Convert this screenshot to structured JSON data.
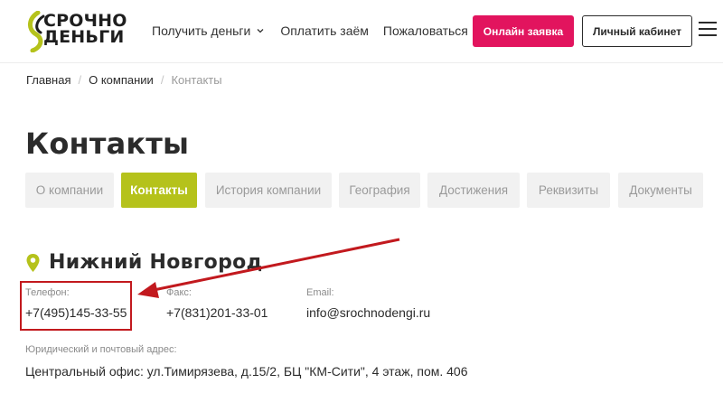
{
  "header": {
    "logo_line1": "СРОЧНО",
    "logo_line2": "ДЕНЬГИ",
    "nav": [
      {
        "label": "Получить деньги"
      },
      {
        "label": "Оплатить заём"
      },
      {
        "label": "Пожаловаться"
      }
    ],
    "apply_label": "Онлайн заявка",
    "cabinet_label": "Личный кабинет"
  },
  "breadcrumb": {
    "home": "Главная",
    "about": "О компании",
    "current": "Контакты",
    "separator": "/"
  },
  "page": {
    "title": "Контакты"
  },
  "tabs": [
    {
      "label": "О компании",
      "active": false
    },
    {
      "label": "Контакты",
      "active": true
    },
    {
      "label": "История компании",
      "active": false
    },
    {
      "label": "География",
      "active": false
    },
    {
      "label": "Достижения",
      "active": false
    },
    {
      "label": "Реквизиты",
      "active": false
    },
    {
      "label": "Документы",
      "active": false
    }
  ],
  "city": {
    "name": "Нижний Новгород"
  },
  "contacts": {
    "phone_label": "Телефон:",
    "phone": "+7(495)145-33-55",
    "fax_label": "Факс:",
    "fax": "+7(831)201-33-01",
    "email_label": "Email:",
    "email": "info@srochnodengi.ru",
    "address_label": "Юридический и почтовый адрес:",
    "address": "Центральный офис: ул.Тимирязева, д.15/2, БЦ \"КМ-Сити\", 4 этаж, пом. 406"
  },
  "colors": {
    "accent_pink": "#e2145e",
    "accent_green": "#b5c21b",
    "annotation_red": "#c2191e"
  },
  "icons": {
    "pin": "map-pin-icon",
    "chevron": "chevron-down-icon",
    "menu": "hamburger-menu-icon"
  }
}
